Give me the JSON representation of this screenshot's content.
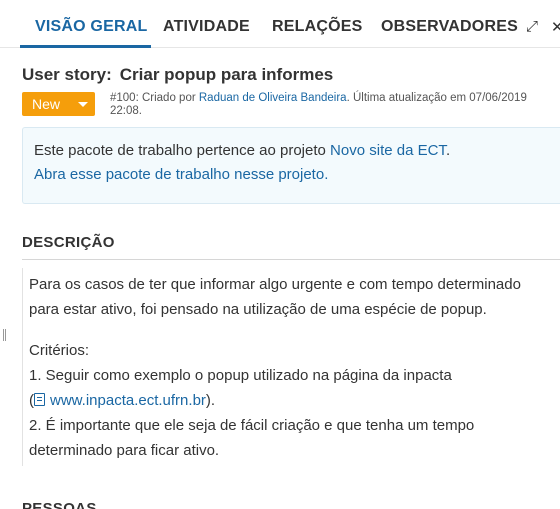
{
  "tabs": [
    {
      "label": "VISÃO GERAL",
      "active": true
    },
    {
      "label": "ATIVIDADE"
    },
    {
      "label": "RELAÇÕES"
    },
    {
      "label": "OBSERVADORES"
    }
  ],
  "tab_actions": {
    "expand_icon": "⤢",
    "close_icon": "✕"
  },
  "work_package": {
    "type": "User story:",
    "subject": "Criar popup para informes",
    "status": "New",
    "meta": {
      "prefix": "#100: Criado por",
      "author": "Raduan de Oliveira Bandeira",
      "updated": ". Última atualização em 07/06/2019",
      "time": "22:08."
    }
  },
  "notice": {
    "text": "Este pacote de trabalho pertence ao projeto",
    "project": "Novo site da ECT",
    "link": "Abra esse pacote de trabalho nesse projeto."
  },
  "sections": {
    "description": "DESCRIÇÃO",
    "people": "PESSOAS"
  },
  "description": {
    "p1": "Para os casos de ter que informar algo urgente e com tempo determinado",
    "p2": "para estar ativo, foi pensado na utilização de uma espécie de popup.",
    "criteria": "Critérios:",
    "c1": "1. Seguir como exemplo o popup utilizado na página da inpacta",
    "c1_link": "www.inpacta.ect.ufrn.br",
    "c2": "2. É importante que ele seja de fácil criação e que tenha um tempo",
    "c2b": "determinado para ficar ativo."
  },
  "colors": {
    "accent": "#1a67a3",
    "status_new": "#f59e0b",
    "notice_bg": "#f3fafd"
  }
}
